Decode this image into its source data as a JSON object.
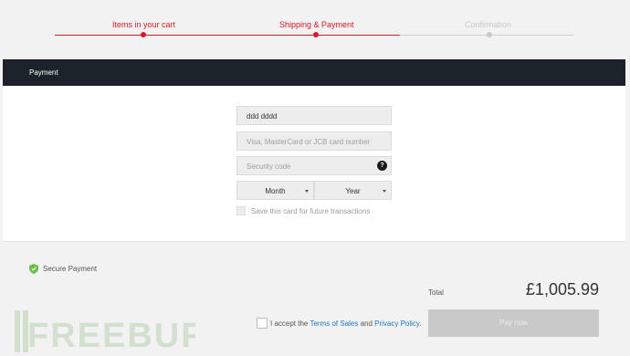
{
  "steps": [
    {
      "label": "Items in your cart",
      "state": "done"
    },
    {
      "label": "Shipping & Payment",
      "state": "current"
    },
    {
      "label": "Confirmation",
      "state": "todo"
    }
  ],
  "colors": {
    "accent": "#d7192d",
    "header_bg": "#1b2229",
    "link": "#1e73be",
    "secure": "#6abf4b"
  },
  "payment": {
    "title": "Payment",
    "card_name_value": "ddd dddd",
    "card_number_placeholder": "Visa, MasterCard or JCB card number",
    "security_code_placeholder": "Security code",
    "help_icon": "?",
    "month_label": "Month",
    "year_label": "Year",
    "save_card_label": "Save this card for future transactions"
  },
  "summary": {
    "secure_label": "Secure Payment",
    "total_label": "Total",
    "total_amount": "£1,005.99",
    "terms_prefix": "I accept the ",
    "terms_link": "Terms of Sales",
    "terms_and": " and ",
    "privacy_link": "Privacy Policy",
    "terms_suffix": ".",
    "pay_label": "Pay now"
  },
  "watermark": {
    "text": "FREEBUF"
  }
}
